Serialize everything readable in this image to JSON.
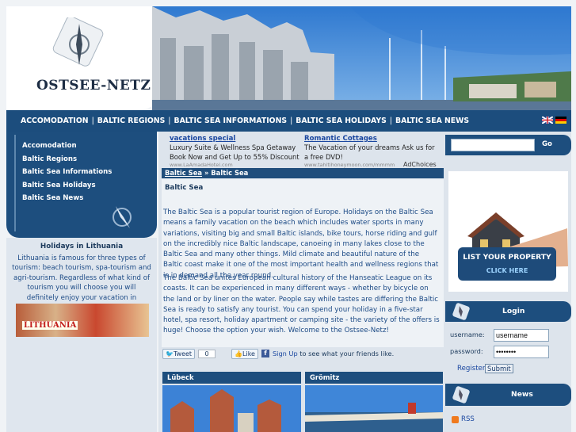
{
  "site": {
    "logo_text": "OSTSEE-NETZ"
  },
  "nav": {
    "items": [
      "ACCOMODATION",
      "BALTIC REGIONS",
      "BALTIC SEA INFORMATIONS",
      "BALTIC SEA HOLIDAYS",
      "BALTIC SEA NEWS"
    ],
    "separator": "|"
  },
  "sidebar": {
    "items": [
      "Accomodation",
      "Baltic Regions",
      "Baltic Sea Informations",
      "Baltic Sea Holidays",
      "Baltic Sea News"
    ]
  },
  "promo": {
    "title": "Holidays in Lithuania",
    "text": "Lithuania is famous for three types of tourism: beach tourism, spa-tourism and agri-tourism. Regardless of what kind of tourism you will choose you will definitely enjoy your vacation in Lithuania.",
    "image_label": "LITHUANIA"
  },
  "ads": [
    {
      "title": "vacations special",
      "text": "Luxury Suite & Wellness Spa Getaway Book Now and Get Up to 55% Discount",
      "url": "www.LaAmadaHotel.com"
    },
    {
      "title": "Romantic Cottages",
      "text": "The Vacation of your dreams Ask us for a free DVD!",
      "url": "www.tahitihoneymoon.com/mmmm"
    }
  ],
  "adchoices": "AdChoices",
  "breadcrumb": {
    "link": "Baltic Sea",
    "sep": "»",
    "current": "Baltic Sea"
  },
  "article": {
    "heading": "Baltic Sea",
    "p1": "The Baltic Sea is a popular tourist region of Europe. Holidays on the Baltic Sea means a family vacation on the beach which includes water sports in many variations, visiting big and small Baltic islands, bike tours, horse riding and gulf on the incredibly nice Baltic landscape, canoeing in many lakes close to the Baltic Sea and many other things. Mild climate and beautiful nature of the Baltic coast make it one of the most important health and wellness regions that is in demand all the year round.",
    "p2": "The Baltic Sea unites European cultural history of the Hanseatic League on its coasts. It can be experienced in many different ways - whether by bicycle on the land or by liner on the water. People say while tastes are differing the Baltic Sea is ready to satisfy any tourist. You can spend your holiday in a five-star hotel, spa resort, holiday apartment or camping site - the variety of the offers is huge! Choose the option your wish. Welcome to the Ostsee-Netz!"
  },
  "social": {
    "tweet": "Tweet",
    "count": "0",
    "like": "Like",
    "signup": "Sign Up",
    "signup_rest": " to see what your friends like."
  },
  "boxes": [
    {
      "title": "Lübeck"
    },
    {
      "title": "Grömitz"
    }
  ],
  "search": {
    "value": "",
    "go": "Go"
  },
  "listprop": {
    "line1": "LIST YOUR PROPERTY",
    "line2": "CLICK HERE"
  },
  "login": {
    "title": "Login",
    "username_label": "username:",
    "password_label": "password:",
    "username_value": "username",
    "password_value": "••••••••",
    "register": "Register",
    "submit": "Submit"
  },
  "news": {
    "title": "News",
    "rss": "RSS"
  },
  "colors": {
    "navy": "#1d4e7e",
    "link": "#1a47a0",
    "text": "#1d4b86"
  }
}
